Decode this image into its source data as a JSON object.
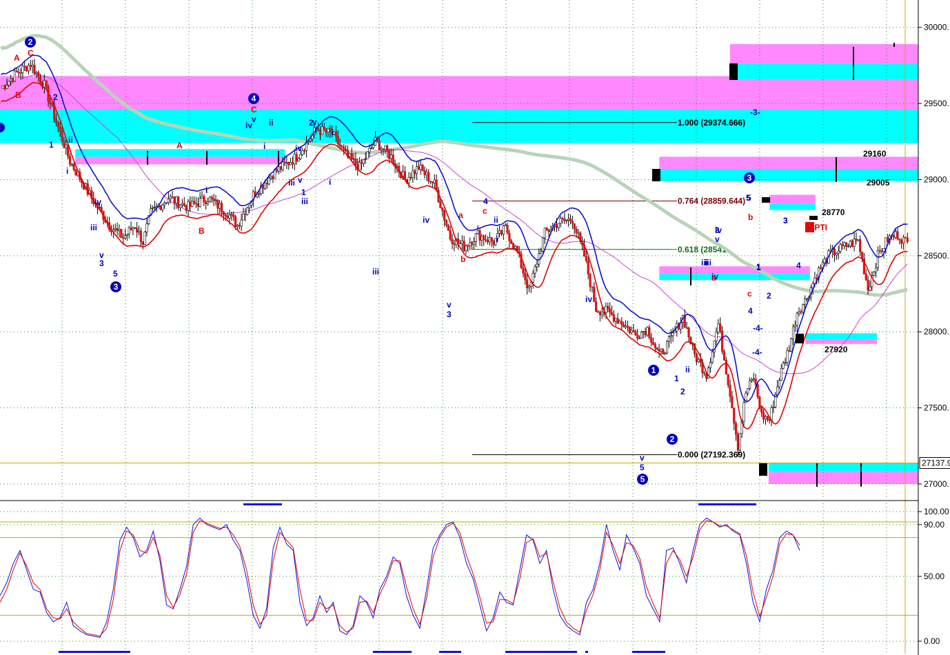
{
  "colors": {
    "up": "#ffffff",
    "down": "#e01010",
    "wick": "#000000",
    "blue_ma": "#1010d0",
    "red_ma": "#e00000",
    "magenta_ma": "#d040d0",
    "sage_ma": "#b8d4b8",
    "magenta_zone": "#ff88ff",
    "cyan_zone": "#00ffff",
    "grid": "#2a8a2a",
    "hline": "#c8a800",
    "osc_blue": "#1010e0",
    "osc_red": "#e00000",
    "wave_blue": "#0000c0",
    "wave_red": "#e00000",
    "fib_dark": "#7a0000",
    "fib_green": "#107010",
    "fib_black": "#000000"
  },
  "chart_data": [
    {
      "type": "candlestick",
      "title": "",
      "xlabel": "",
      "ylabel": "",
      "ylim": [
        26900,
        30180
      ],
      "y_ticks": [
        "30000.",
        "29500.",
        "29000.",
        "28500.",
        "28000.",
        "27500.",
        "27000."
      ],
      "y_tick_values": [
        30000,
        29500,
        29000,
        28500,
        28000,
        27500,
        27000
      ],
      "current_price_label": "27137.9",
      "current_price": 27137.9,
      "grid": true,
      "anchor_points": [
        [
          0,
          29600
        ],
        [
          8,
          29700
        ],
        [
          15,
          29760
        ],
        [
          22,
          29620
        ],
        [
          28,
          29380
        ],
        [
          35,
          29120
        ],
        [
          45,
          28900
        ],
        [
          55,
          28700
        ],
        [
          62,
          28620
        ],
        [
          68,
          28700
        ],
        [
          72,
          28590
        ],
        [
          76,
          28780
        ],
        [
          85,
          28880
        ],
        [
          95,
          28820
        ],
        [
          105,
          28880
        ],
        [
          115,
          28780
        ],
        [
          120,
          28700
        ],
        [
          128,
          28900
        ],
        [
          138,
          29040
        ],
        [
          150,
          29150
        ],
        [
          160,
          29330
        ],
        [
          168,
          29300
        ],
        [
          175,
          29160
        ],
        [
          182,
          29080
        ],
        [
          190,
          29250
        ],
        [
          198,
          29150
        ],
        [
          205,
          29000
        ],
        [
          212,
          29080
        ],
        [
          220,
          28970
        ],
        [
          228,
          28620
        ],
        [
          235,
          28560
        ],
        [
          242,
          28640
        ],
        [
          250,
          28590
        ],
        [
          256,
          28680
        ],
        [
          262,
          28520
        ],
        [
          268,
          28270
        ],
        [
          276,
          28650
        ],
        [
          283,
          28720
        ],
        [
          290,
          28740
        ],
        [
          296,
          28500
        ],
        [
          302,
          28150
        ],
        [
          308,
          28130
        ],
        [
          315,
          28060
        ],
        [
          322,
          27980
        ],
        [
          328,
          28020
        ],
        [
          334,
          27840
        ],
        [
          340,
          27950
        ],
        [
          346,
          28100
        ],
        [
          352,
          27850
        ],
        [
          358,
          27720
        ],
        [
          364,
          28050
        ],
        [
          370,
          27600
        ],
        [
          374,
          27250
        ],
        [
          378,
          27600
        ],
        [
          382,
          27700
        ],
        [
          386,
          27450
        ],
        [
          390,
          27420
        ],
        [
          395,
          27700
        ],
        [
          400,
          27900
        ],
        [
          404,
          28130
        ],
        [
          408,
          28200
        ],
        [
          414,
          28380
        ],
        [
          420,
          28500
        ],
        [
          428,
          28560
        ],
        [
          435,
          28600
        ],
        [
          440,
          28280
        ],
        [
          445,
          28500
        ],
        [
          450,
          28610
        ],
        [
          455,
          28640
        ],
        [
          460,
          28580
        ]
      ],
      "series": [
        {
          "name": "",
          "kind": "ma_blue"
        },
        {
          "name": "",
          "kind": "ma_red"
        },
        {
          "name": "",
          "kind": "ma_magenta"
        },
        {
          "name": "",
          "kind": "ma_sage"
        }
      ],
      "zones": [
        {
          "color": "magenta",
          "y_top": 29680,
          "y_bottom": 29460,
          "x_start": 0,
          "x_end": 1.0
        },
        {
          "color": "cyan",
          "y_top": 29460,
          "y_bottom": 29240,
          "x_start": 0,
          "x_end": 1.0
        },
        {
          "color": "cyan",
          "y_top": 29200,
          "y_bottom": 29150,
          "x_start": 0.082,
          "x_end": 0.31
        },
        {
          "color": "magenta",
          "y_top": 29150,
          "y_bottom": 29100,
          "x_start": 0.082,
          "x_end": 0.31
        },
        {
          "color": "magenta",
          "y_top": 29890,
          "y_bottom": 29760,
          "x_start": 0.795,
          "x_end": 1.0
        },
        {
          "color": "cyan",
          "y_top": 29760,
          "y_bottom": 29660,
          "x_start": 0.795,
          "x_end": 1.0
        },
        {
          "color": "magenta",
          "y_top": 29150,
          "y_bottom": 29070,
          "x_start": 0.718,
          "x_end": 1.0
        },
        {
          "color": "cyan",
          "y_top": 29070,
          "y_bottom": 28990,
          "x_start": 0.718,
          "x_end": 1.0
        },
        {
          "color": "magenta",
          "y_top": 28900,
          "y_bottom": 28840,
          "x_start": 0.838,
          "x_end": 0.888
        },
        {
          "color": "cyan",
          "y_top": 28840,
          "y_bottom": 28800,
          "x_start": 0.838,
          "x_end": 0.888
        },
        {
          "color": "magenta",
          "y_top": 28430,
          "y_bottom": 28380,
          "x_start": 0.718,
          "x_end": 0.882
        },
        {
          "color": "cyan",
          "y_top": 28380,
          "y_bottom": 28340,
          "x_start": 0.718,
          "x_end": 0.882
        },
        {
          "color": "cyan",
          "y_top": 27990,
          "y_bottom": 27950,
          "x_start": 0.877,
          "x_end": 0.955
        },
        {
          "color": "magenta",
          "y_top": 27950,
          "y_bottom": 27920,
          "x_start": 0.877,
          "x_end": 0.955
        },
        {
          "color": "cyan",
          "y_top": 27140,
          "y_bottom": 27080,
          "x_start": 0.837,
          "x_end": 1.0
        },
        {
          "color": "magenta",
          "y_top": 27080,
          "y_bottom": 27000,
          "x_start": 0.837,
          "x_end": 1.0
        }
      ],
      "fib_levels": [
        {
          "label": "1.000 (29374.666)",
          "price": 29374.666,
          "color": "black"
        },
        {
          "label": "0.764 (28859.644)",
          "price": 28859.644,
          "color": "dark"
        },
        {
          "label": "0.618 (28541.",
          "price": 28541,
          "color": "green"
        },
        {
          "label": "0.000 (27192.369)",
          "price": 27192.369,
          "color": "black"
        }
      ],
      "level_labels": [
        "29160",
        "29005",
        "28770",
        "27920"
      ],
      "level_values": [
        29160,
        29005,
        28770,
        27920
      ],
      "annotations": {
        "pti": "48PTI",
        "dash3": "-3-",
        "dash4": "-4-"
      },
      "wave_labels_blue": [
        "1",
        "ii",
        "i",
        "iii",
        "iv",
        "v",
        "3",
        "5",
        "2",
        "i",
        "iii",
        "iv",
        "v",
        "1",
        "iii",
        "v",
        "ii",
        "i",
        "i",
        "iv",
        "v",
        "i",
        "ii",
        "iv",
        "2",
        "4",
        "v",
        "iii",
        "iv",
        "v",
        "3",
        "iv",
        "iii",
        "v",
        "5",
        "1",
        "2",
        "1",
        "ii",
        "iii",
        "iv",
        "3",
        "5",
        "1",
        "2",
        "3",
        "4",
        "5",
        "i",
        "3",
        "4",
        "-4-"
      ],
      "wave_labels_red": [
        "A",
        "C",
        "B",
        "C",
        "A",
        "B",
        "a",
        "c",
        "b",
        "a",
        "b",
        "c"
      ],
      "circled_labels": [
        "2",
        "3",
        "4",
        "5",
        "1",
        "2",
        "3"
      ]
    },
    {
      "type": "line",
      "title": "",
      "ylim": [
        0,
        100
      ],
      "y_ticks": [
        "100.00",
        "90.00",
        "50.00",
        "0.00"
      ],
      "y_tick_values": [
        100,
        90,
        50,
        0
      ],
      "reference_levels": [
        92,
        80,
        20
      ],
      "series": [
        {
          "name": "",
          "values": [
            35,
            45,
            60,
            70,
            55,
            40,
            38,
            22,
            15,
            18,
            30,
            12,
            8,
            5,
            4,
            3,
            15,
            40,
            78,
            88,
            80,
            65,
            70,
            85,
            62,
            28,
            25,
            40,
            58,
            90,
            95,
            90,
            88,
            86,
            90,
            78,
            70,
            48,
            20,
            10,
            25,
            72,
            88,
            75,
            70,
            30,
            12,
            18,
            35,
            22,
            30,
            8,
            5,
            12,
            35,
            30,
            18,
            40,
            50,
            65,
            60,
            35,
            20,
            10,
            40,
            72,
            82,
            90,
            92,
            80,
            60,
            48,
            28,
            8,
            18,
            38,
            30,
            28,
            55,
            82,
            78,
            60,
            70,
            40,
            20,
            12,
            8,
            5,
            30,
            40,
            60,
            90,
            70,
            55,
            82,
            72,
            60,
            35,
            25,
            15,
            70,
            72,
            60,
            45,
            70,
            90,
            95,
            92,
            88,
            90,
            85,
            82,
            60,
            30,
            15,
            40,
            55,
            80,
            85,
            82,
            70
          ]
        },
        {
          "name": "",
          "values": [
            30,
            40,
            55,
            68,
            58,
            45,
            40,
            25,
            18,
            17,
            25,
            15,
            10,
            6,
            5,
            4,
            10,
            32,
            70,
            85,
            82,
            70,
            68,
            80,
            66,
            35,
            26,
            36,
            52,
            84,
            93,
            91,
            89,
            87,
            88,
            82,
            73,
            55,
            28,
            13,
            20,
            62,
            84,
            78,
            72,
            40,
            16,
            16,
            30,
            25,
            28,
            12,
            7,
            10,
            30,
            31,
            22,
            36,
            47,
            62,
            62,
            42,
            25,
            13,
            33,
            65,
            80,
            88,
            91,
            84,
            66,
            52,
            34,
            14,
            15,
            32,
            32,
            29,
            48,
            76,
            79,
            65,
            68,
            46,
            26,
            15,
            10,
            7,
            24,
            36,
            55,
            84,
            74,
            60,
            76,
            74,
            64,
            42,
            29,
            18,
            60,
            70,
            63,
            50,
            65,
            86,
            93,
            92,
            89,
            89,
            86,
            83,
            66,
            38,
            19,
            34,
            50,
            75,
            83,
            82,
            74
          ]
        }
      ]
    }
  ]
}
